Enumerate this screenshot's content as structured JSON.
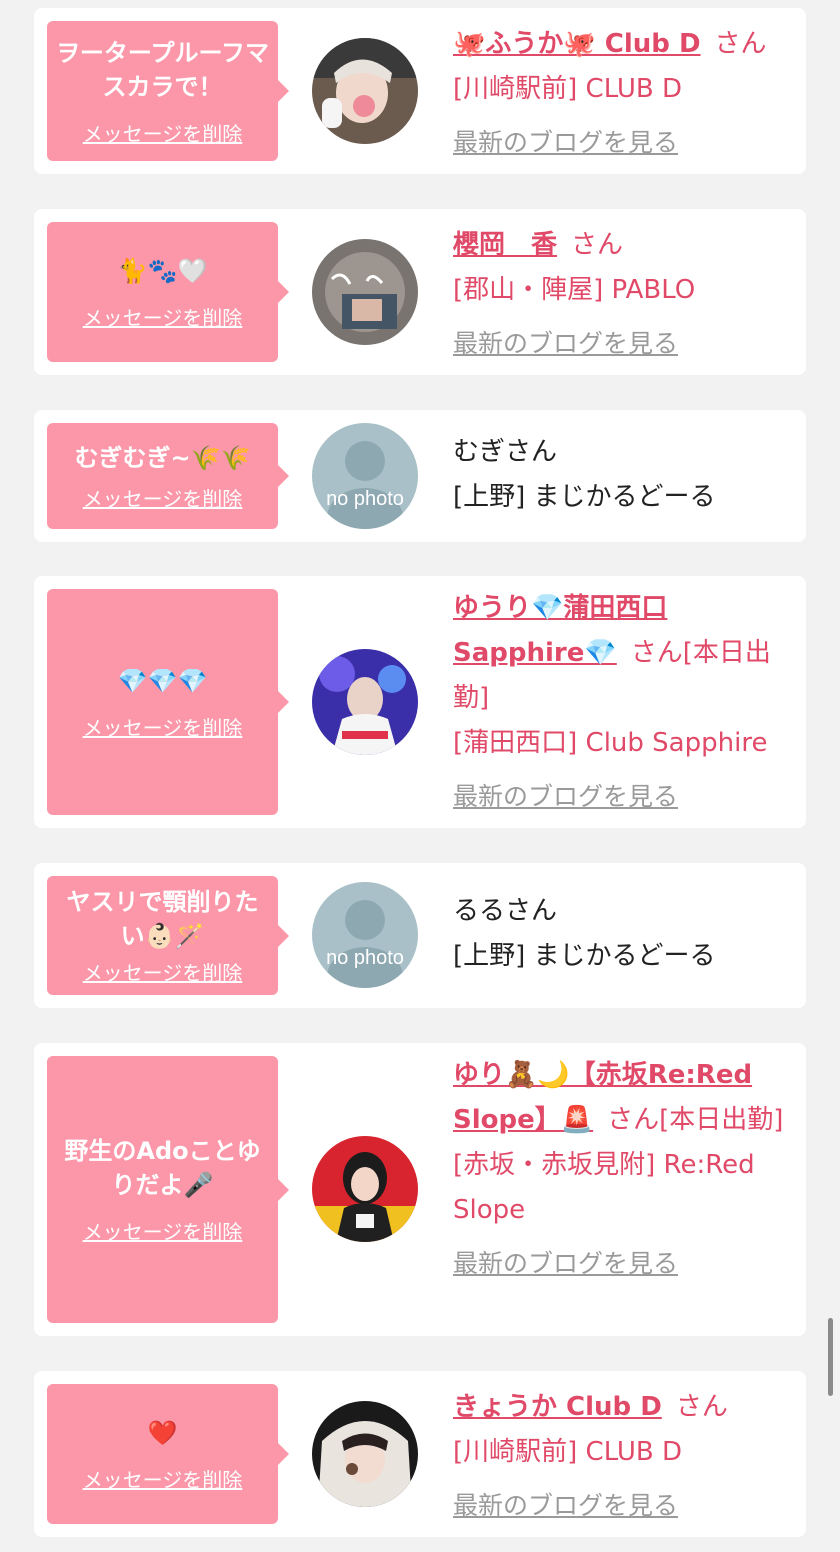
{
  "delete_label": "メッセージを削除",
  "blog_label": "最新のブログを見る",
  "san_suffix": "さん",
  "colors": {
    "accent": "#e04a68",
    "bubble": "#fb97a8",
    "background": "#f2f2f2"
  },
  "cards": [
    {
      "message": "ヲータープルーフマスカラで！",
      "name": "🐙ふうか🐙 Club D",
      "shop": "[川崎駅前] CLUB D"
    },
    {
      "message": "🐈🐾🤍",
      "name": "櫻岡　香",
      "shop": "[郡山・陣屋] PABLO"
    },
    {
      "message": "むぎむぎ~🌾🌾",
      "name_plain": "むぎさん",
      "shop": "[上野] まじかるどーる",
      "avatar_text": "no photo"
    },
    {
      "message": "💎💎💎",
      "name": "ゆうり💎蒲田西口Sapphire💎",
      "status": "[本日出勤]",
      "shop": "[蒲田西口] Club Sapphire"
    },
    {
      "message": "ヤスリで顎削りたい👶🏻🪄",
      "name_plain": "るるさん",
      "shop": "[上野] まじかるどーる",
      "avatar_text": "no photo"
    },
    {
      "message": "野生のAdoことゆりだよ🎤",
      "name": "ゆり🧸🌙【赤坂Re:Red Slope】🚨",
      "status": "[本日出勤]",
      "shop": "[赤坂・赤坂見附] Re:Red Slope"
    },
    {
      "message": "❤️",
      "name": "きょうか Club D",
      "shop": "[川崎駅前] CLUB D"
    }
  ]
}
